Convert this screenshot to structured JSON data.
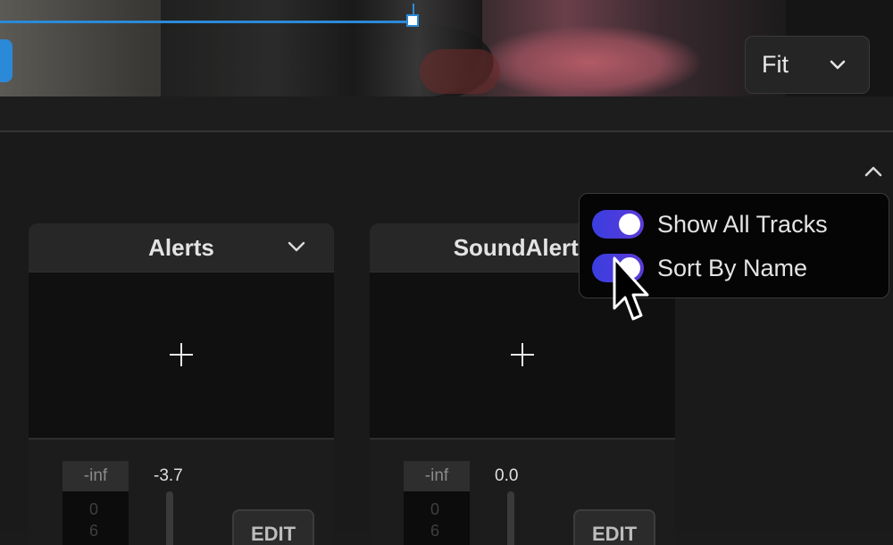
{
  "preview": {
    "zoom_select": {
      "value": "Fit",
      "icon": "chevron-down-icon"
    }
  },
  "panel": {
    "collapse_icon": "chevron-up-icon"
  },
  "tracks": [
    {
      "title": "Alerts",
      "add_icon": "plus-icon",
      "meter_label": "-inf",
      "meter_ticks": [
        "0",
        "6"
      ],
      "level": "-3.7",
      "edit_label": "EDIT"
    },
    {
      "title": "SoundAlerts",
      "add_icon": "plus-icon",
      "meter_label": "-inf",
      "meter_ticks": [
        "0",
        "6"
      ],
      "level": "0.0",
      "edit_label": "EDIT"
    }
  ],
  "popover": {
    "options": [
      {
        "label": "Show All Tracks",
        "enabled": true
      },
      {
        "label": "Sort By Name",
        "enabled": true
      }
    ]
  },
  "colors": {
    "accent": "#2b8ad8",
    "toggle_on": "#4a3cdc",
    "panel_bg": "#1a1a1a"
  }
}
